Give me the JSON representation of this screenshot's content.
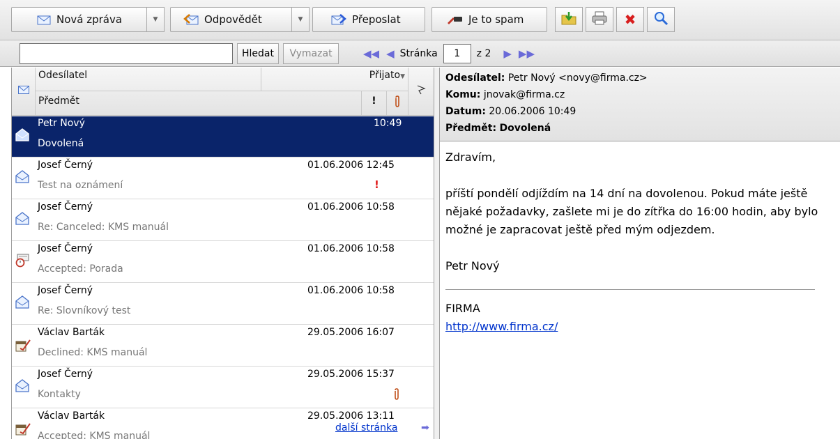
{
  "toolbar": {
    "new_message": "Nová zpráva",
    "reply": "Odpovědět",
    "forward": "Přeposlat",
    "spam": "Je to spam"
  },
  "search": {
    "value": "",
    "search_button": "Hledat",
    "clear_button": "Vymazat"
  },
  "pager": {
    "page_label": "Stránka",
    "current_page": "1",
    "of_label": "z 2"
  },
  "list": {
    "header": {
      "sender": "Odesílatel",
      "received": "Přijato",
      "subject": "Předmět",
      "importance": "!"
    },
    "rows": [
      {
        "sender": "Petr Nový",
        "subject": "Dovolená",
        "date": "10:49",
        "icon": "envelope-open-icon"
      },
      {
        "sender": "Josef Černý",
        "subject": "Test na oznámení",
        "date": "01.06.2006 12:45",
        "icon": "envelope-open-icon",
        "importance": "!"
      },
      {
        "sender": "Josef Černý",
        "subject": "Re: Canceled: KMS manuál",
        "date": "01.06.2006 10:58",
        "icon": "envelope-open-icon"
      },
      {
        "sender": "Josef Černý",
        "subject": "Accepted: Porada",
        "date": "01.06.2006 10:58",
        "icon": "meeting-accepted-icon"
      },
      {
        "sender": "Josef Černý",
        "subject": "Re: Slovníkový test",
        "date": "01.06.2006 10:58",
        "icon": "envelope-open-icon"
      },
      {
        "sender": "Václav Barták",
        "subject": "Declined: KMS manuál",
        "date": "29.05.2006 16:07",
        "icon": "meeting-response-icon"
      },
      {
        "sender": "Josef Černý",
        "subject": "Kontakty",
        "date": "29.05.2006 15:37",
        "icon": "envelope-open-icon",
        "attachment": true
      },
      {
        "sender": "Václav Barták",
        "subject": "Accepted: KMS manuál",
        "date": "29.05.2006 13:11",
        "icon": "meeting-response-icon"
      }
    ],
    "next_page": "další stránka"
  },
  "preview": {
    "from_label": "Odesílatel:",
    "from_value": "Petr Nový <novy@firma.cz>",
    "to_label": "Komu:",
    "to_value": "jnovak@firma.cz",
    "date_label": "Datum:",
    "date_value": "20.06.2006 10:49",
    "subject_label": "Předmět:",
    "subject_value": "Dovolená",
    "greeting": "Zdravím,",
    "body": "příští pondělí odjíždím na 14 dní na dovolenou. Pokud máte ještě nějaké požadavky, zašlete mi je do zítřka do 16:00 hodin, aby bylo možné je zapracovat ještě před mým odjezdem.",
    "signature_name": "Petr Nový",
    "company": "FIRMA",
    "link": "http://www.firma.cz/"
  },
  "colors": {
    "selection": "#0a246a",
    "link": "#0033cc",
    "importance": "#e02020"
  }
}
